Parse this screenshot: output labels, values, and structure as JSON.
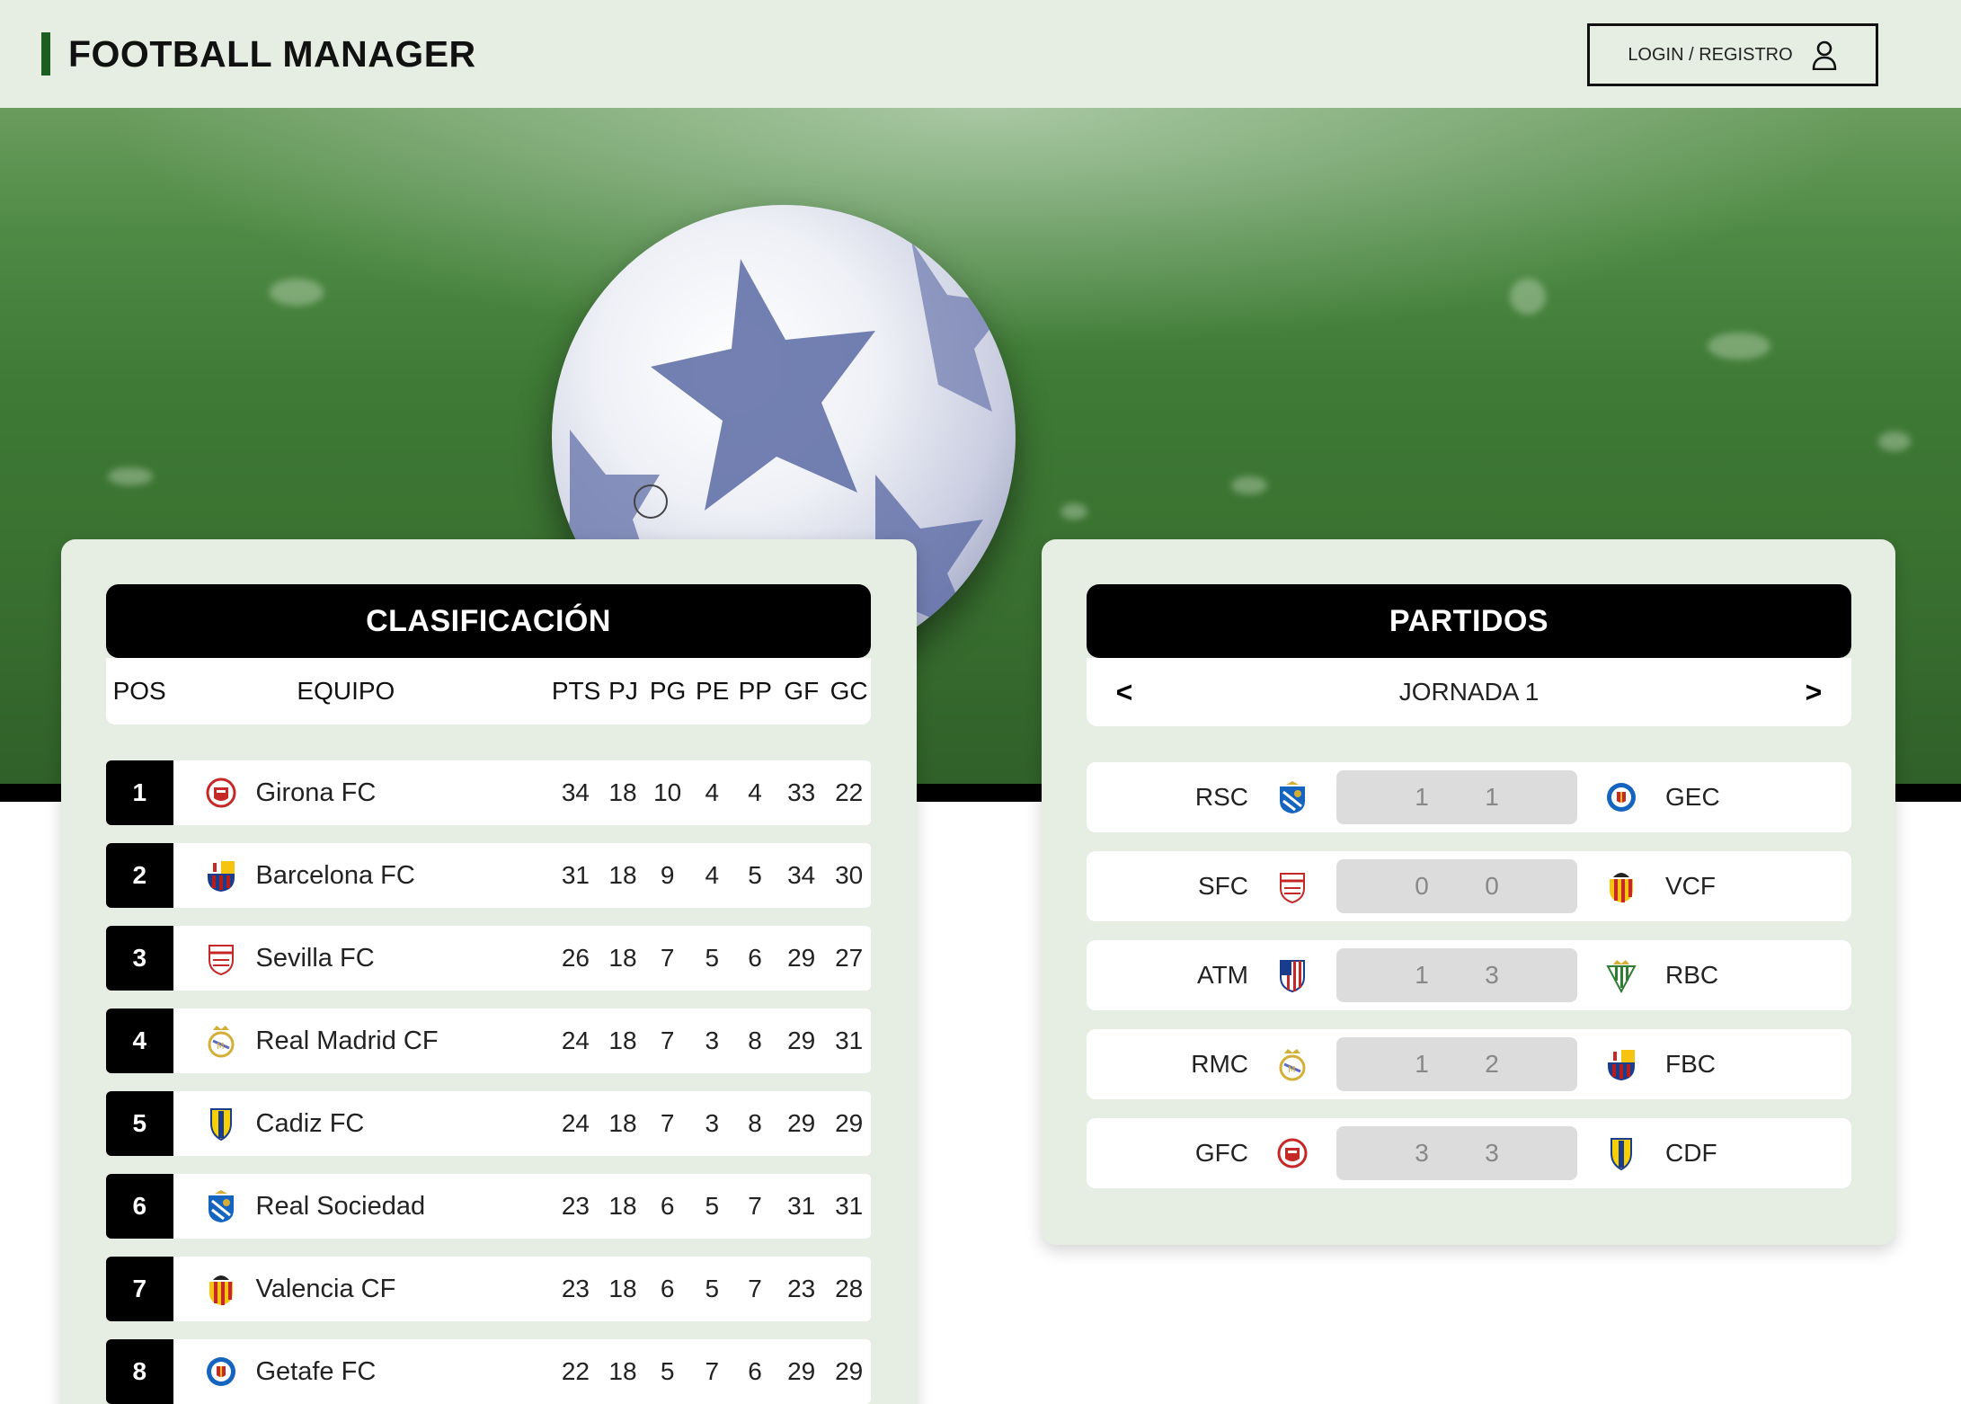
{
  "header": {
    "brand": "FOOTBALL MANAGER",
    "login_label": "LOGIN / REGISTRO"
  },
  "standings": {
    "title": "CLASIFICACIÓN",
    "columns": {
      "pos": "POS",
      "team": "EQUIPO",
      "pts": "PTS",
      "pj": "PJ",
      "pg": "PG",
      "pe": "PE",
      "pp": "PP",
      "gf": "GF",
      "gc": "GC"
    },
    "rows": [
      {
        "pos": "1",
        "team": "Girona FC",
        "crest": "girona-crest-icon",
        "pts": "34",
        "pj": "18",
        "pg": "10",
        "pe": "4",
        "pp": "4",
        "gf": "33",
        "gc": "22"
      },
      {
        "pos": "2",
        "team": "Barcelona FC",
        "crest": "barcelona-crest-icon",
        "pts": "31",
        "pj": "18",
        "pg": "9",
        "pe": "4",
        "pp": "5",
        "gf": "34",
        "gc": "30"
      },
      {
        "pos": "3",
        "team": "Sevilla FC",
        "crest": "sevilla-crest-icon",
        "pts": "26",
        "pj": "18",
        "pg": "7",
        "pe": "5",
        "pp": "6",
        "gf": "29",
        "gc": "27"
      },
      {
        "pos": "4",
        "team": "Real Madrid CF",
        "crest": "real-madrid-crest-icon",
        "pts": "24",
        "pj": "18",
        "pg": "7",
        "pe": "3",
        "pp": "8",
        "gf": "29",
        "gc": "31"
      },
      {
        "pos": "5",
        "team": "Cadiz FC",
        "crest": "cadiz-crest-icon",
        "pts": "24",
        "pj": "18",
        "pg": "7",
        "pe": "3",
        "pp": "8",
        "gf": "29",
        "gc": "29"
      },
      {
        "pos": "6",
        "team": "Real Sociedad",
        "crest": "real-sociedad-crest-icon",
        "pts": "23",
        "pj": "18",
        "pg": "6",
        "pe": "5",
        "pp": "7",
        "gf": "31",
        "gc": "31"
      },
      {
        "pos": "7",
        "team": "Valencia CF",
        "crest": "valencia-crest-icon",
        "pts": "23",
        "pj": "18",
        "pg": "6",
        "pe": "5",
        "pp": "7",
        "gf": "23",
        "gc": "28"
      },
      {
        "pos": "8",
        "team": "Getafe FC",
        "crest": "getafe-crest-icon",
        "pts": "22",
        "pj": "18",
        "pg": "5",
        "pe": "7",
        "pp": "6",
        "gf": "29",
        "gc": "29"
      }
    ]
  },
  "matches": {
    "title": "PARTIDOS",
    "round_label": "JORNADA 1",
    "prev_label": "<",
    "next_label": ">",
    "items": [
      {
        "home": "RSC",
        "home_crest": "real-sociedad-crest-icon",
        "home_goals": "1",
        "away_goals": "1",
        "away": "GEC",
        "away_crest": "getafe-crest-icon"
      },
      {
        "home": "SFC",
        "home_crest": "sevilla-crest-icon",
        "home_goals": "0",
        "away_goals": "0",
        "away": "VCF",
        "away_crest": "valencia-crest-icon"
      },
      {
        "home": "ATM",
        "home_crest": "atletico-crest-icon",
        "home_goals": "1",
        "away_goals": "3",
        "away": "RBC",
        "away_crest": "betis-crest-icon"
      },
      {
        "home": "RMC",
        "home_crest": "real-madrid-crest-icon",
        "home_goals": "1",
        "away_goals": "2",
        "away": "FBC",
        "away_crest": "barcelona-crest-icon"
      },
      {
        "home": "GFC",
        "home_crest": "girona-crest-icon",
        "home_goals": "3",
        "away_goals": "3",
        "away": "CDF",
        "away_crest": "cadiz-crest-icon"
      }
    ]
  },
  "colors": {
    "header_bg": "#e6ede3",
    "brand_accent": "#1b5e20",
    "title_bar": "#000000",
    "score_bg": "#dcdcdc"
  }
}
